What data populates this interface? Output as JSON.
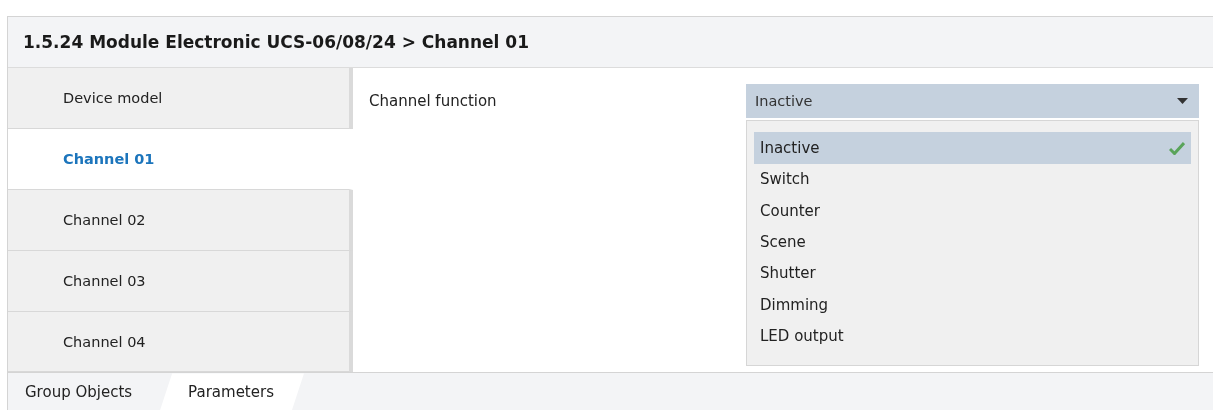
{
  "window": {
    "title": "1.5.24 Module Electronic UCS-06/08/24 > Channel 01"
  },
  "sidebar": {
    "items": [
      {
        "label": "Device model",
        "selected": false
      },
      {
        "label": "Channel 01",
        "selected": true
      },
      {
        "label": "Channel 02",
        "selected": false
      },
      {
        "label": "Channel 03",
        "selected": false
      },
      {
        "label": "Channel 04",
        "selected": false
      }
    ]
  },
  "parameter": {
    "label": "Channel function",
    "value": "Inactive",
    "expanded": true,
    "options": [
      {
        "label": "Inactive",
        "selected": true
      },
      {
        "label": "Switch",
        "selected": false
      },
      {
        "label": "Counter",
        "selected": false
      },
      {
        "label": "Scene",
        "selected": false
      },
      {
        "label": "Shutter",
        "selected": false
      },
      {
        "label": "Dimming",
        "selected": false
      },
      {
        "label": "LED output",
        "selected": false
      }
    ]
  },
  "tabs": [
    {
      "label": "Group Objects",
      "selected": false
    },
    {
      "label": "Parameters",
      "selected": true
    }
  ]
}
